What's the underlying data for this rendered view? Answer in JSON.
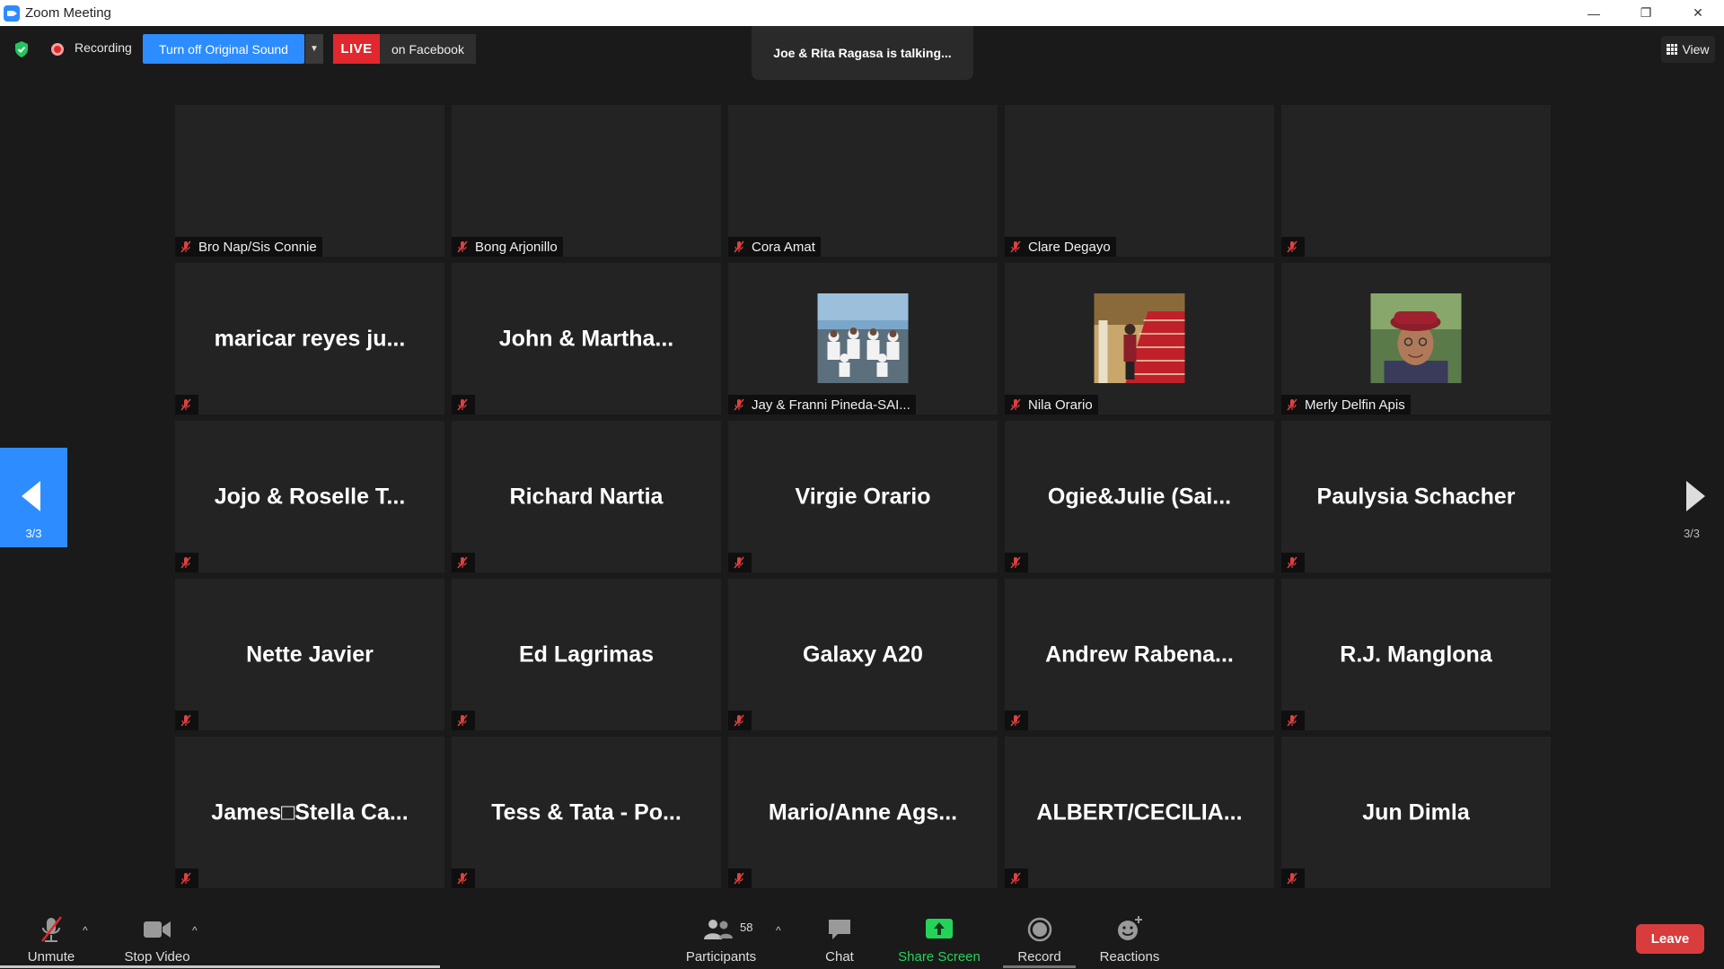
{
  "window": {
    "title": "Zoom Meeting",
    "minimize": "—",
    "restore": "❐",
    "close": "✕"
  },
  "top": {
    "recording_label": "Recording",
    "original_sound_button": "Turn off Original Sound",
    "live_badge": "LIVE",
    "live_destination": "on Facebook",
    "talking_indicator": "Joe & Rita Ragasa is talking...",
    "view_button": "View"
  },
  "nav": {
    "left_page": "3/3",
    "right_page": "3/3"
  },
  "participants": [
    {
      "label": "Bro Nap/Sis Connie",
      "big": ""
    },
    {
      "label": "Bong Arjonillo",
      "big": ""
    },
    {
      "label": "Cora Amat",
      "big": ""
    },
    {
      "label": "Clare Degayo",
      "big": ""
    },
    {
      "label": "",
      "big": ""
    },
    {
      "label": "",
      "big": "maricar reyes ju..."
    },
    {
      "label": "",
      "big": "John & Martha..."
    },
    {
      "label": "Jay & Franni Pineda-SAI...",
      "big": "",
      "photo": "group-photo"
    },
    {
      "label": "Nila Orario",
      "big": "",
      "photo": "staircase-photo"
    },
    {
      "label": "Merly Delfin Apis",
      "big": "",
      "photo": "portrait-photo"
    },
    {
      "label": "",
      "big": "Jojo & Roselle T..."
    },
    {
      "label": "",
      "big": "Richard Nartia"
    },
    {
      "label": "",
      "big": "Virgie Orario"
    },
    {
      "label": "",
      "big": "Ogie&Julie  (Sai..."
    },
    {
      "label": "",
      "big": "Paulysia Schacher"
    },
    {
      "label": "",
      "big": "Nette Javier"
    },
    {
      "label": "",
      "big": "Ed Lagrimas"
    },
    {
      "label": "",
      "big": "Galaxy A20"
    },
    {
      "label": "",
      "big": "Andrew  Rabena..."
    },
    {
      "label": "",
      "big": "R.J. Manglona"
    },
    {
      "label": "",
      "big": "James□Stella Ca..."
    },
    {
      "label": "",
      "big": "Tess & Tata - Po..."
    },
    {
      "label": "",
      "big": "Mario/Anne  Ags..."
    },
    {
      "label": "",
      "big": "ALBERT/CECILIA..."
    },
    {
      "label": "",
      "big": "Jun Dimla"
    }
  ],
  "toolbar": {
    "unmute": "Unmute",
    "stop_video": "Stop Video",
    "participants": "Participants",
    "participant_count": "58",
    "chat": "Chat",
    "share_screen": "Share Screen",
    "record": "Record",
    "reactions": "Reactions",
    "leave": "Leave"
  },
  "colors": {
    "accent": "#2d8cff",
    "live": "#e0282e",
    "leave": "#d83c3c",
    "share": "#24d458"
  }
}
